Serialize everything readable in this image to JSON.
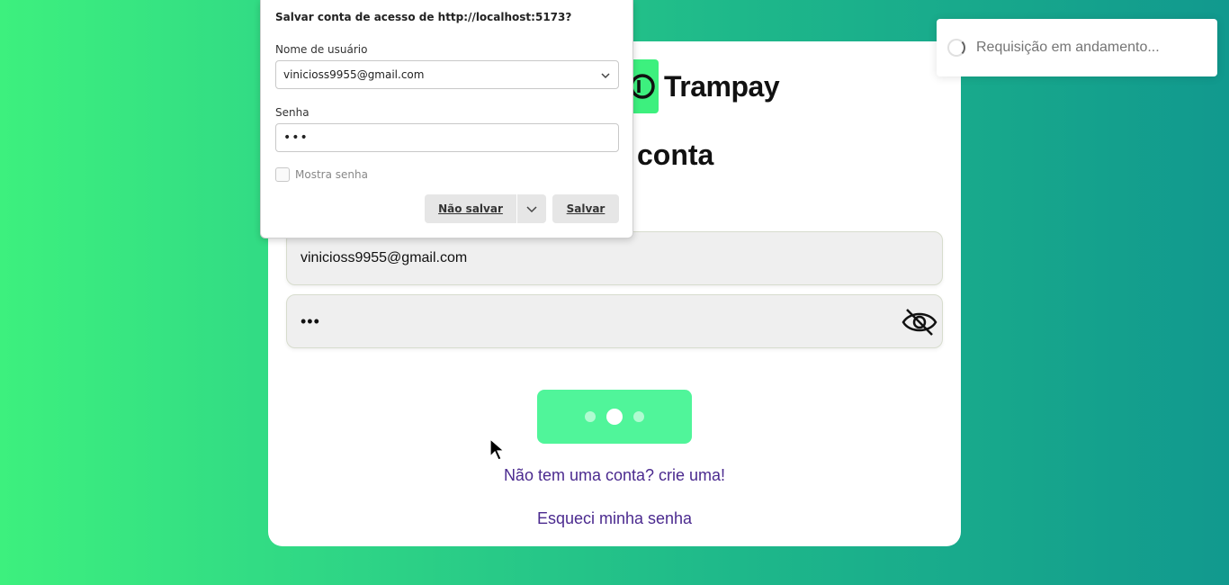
{
  "card": {
    "brand_name": "Trampay",
    "title": "conta",
    "email_value": "vinicioss9955@gmail.com",
    "password_value": "•••",
    "signup_link": "Não tem uma conta? crie uma!",
    "forgot_link": "Esqueci minha senha",
    "brand_color": "#3df07e",
    "button_color": "#50f59a",
    "link_color": "#4b2a8f"
  },
  "toast": {
    "message": "Requisição em andamento...",
    "icon": "spinner-icon"
  },
  "save_dialog": {
    "title": "Salvar conta de acesso de http://localhost:5173?",
    "username_label": "Nome de usuário",
    "username_value": "vinicioss9955@gmail.com",
    "password_label": "Senha",
    "password_value": "•••",
    "show_password_label": "Mostra senha",
    "dont_save_label": "Não salvar",
    "save_label": "Salvar"
  }
}
